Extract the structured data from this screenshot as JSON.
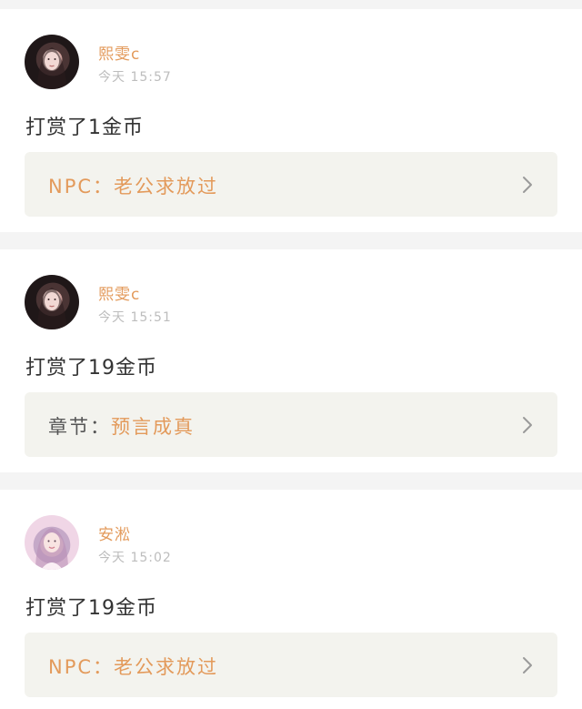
{
  "posts": [
    {
      "username": "熙雯c",
      "time": "今天 15:57",
      "action": "打赏了1金币",
      "ref_label": "NPC：",
      "ref_value": "老公求放过",
      "avatar_icon": "avatar-dark-hair-girl-icon"
    },
    {
      "username": "熙雯c",
      "time": "今天 15:51",
      "action": "打赏了19金币",
      "ref_label": "章节：",
      "ref_value": "预言成真",
      "avatar_icon": "avatar-dark-hair-girl-icon"
    },
    {
      "username": "安淞",
      "time": "今天 15:02",
      "action": "打赏了19金币",
      "ref_label": "NPC：",
      "ref_value": "老公求放过",
      "avatar_icon": "avatar-light-girl-icon"
    }
  ],
  "colors": {
    "accent": "#e39a5b",
    "text": "#333333",
    "muted": "#bdbdbd",
    "card_bg": "#ffffff",
    "ref_bg": "#f3f3ee",
    "page_bg": "#f4f4f4"
  }
}
